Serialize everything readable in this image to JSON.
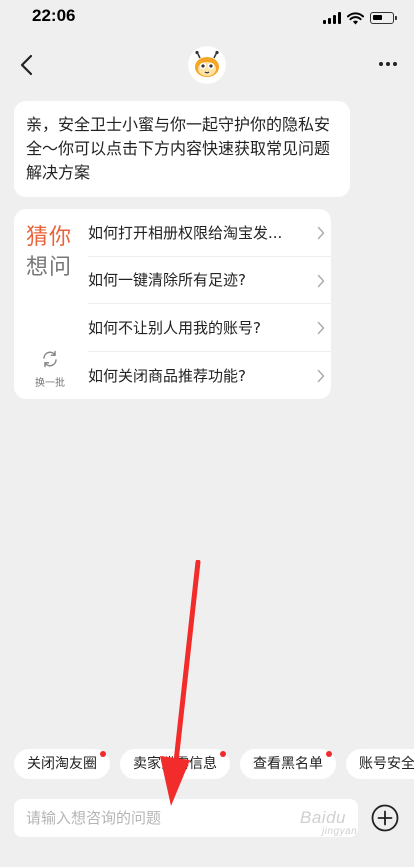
{
  "status_bar": {
    "time": "22:06"
  },
  "nav": {
    "back_icon": "chevron-left-icon",
    "avatar_icon": "bee-mascot-icon",
    "more_icon": "more-horizontal-icon"
  },
  "bubble": {
    "text": "亲，安全卫士小蜜与你一起守护你的隐私安全～你可以点击下方内容快速获取常见问题解决方案"
  },
  "guess": {
    "title_line1": "猜你",
    "title_line2": "想问",
    "refresh_label": "换一批",
    "title_accent_color": "#e8633a",
    "questions": [
      {
        "text": "如何打开相册权限给淘宝发..."
      },
      {
        "text": "如何一键清除所有足迹?"
      },
      {
        "text": "如何不让别人用我的账号?"
      },
      {
        "text": "如何关闭商品推荐功能?"
      }
    ]
  },
  "chips": [
    {
      "label": "关闭淘友圈",
      "has_dot": true
    },
    {
      "label": "卖家泄露信息",
      "has_dot": true
    },
    {
      "label": "查看黑名单",
      "has_dot": true
    },
    {
      "label": "账号安全",
      "has_dot": false
    }
  ],
  "input": {
    "placeholder": "请输入想咨询的问题",
    "plus_icon": "plus-circle-icon"
  },
  "watermark": {
    "text": "Baidu",
    "sub": "jingyan"
  },
  "colors": {
    "badge": "#f02b2b",
    "arrow": "#f22b2b"
  }
}
